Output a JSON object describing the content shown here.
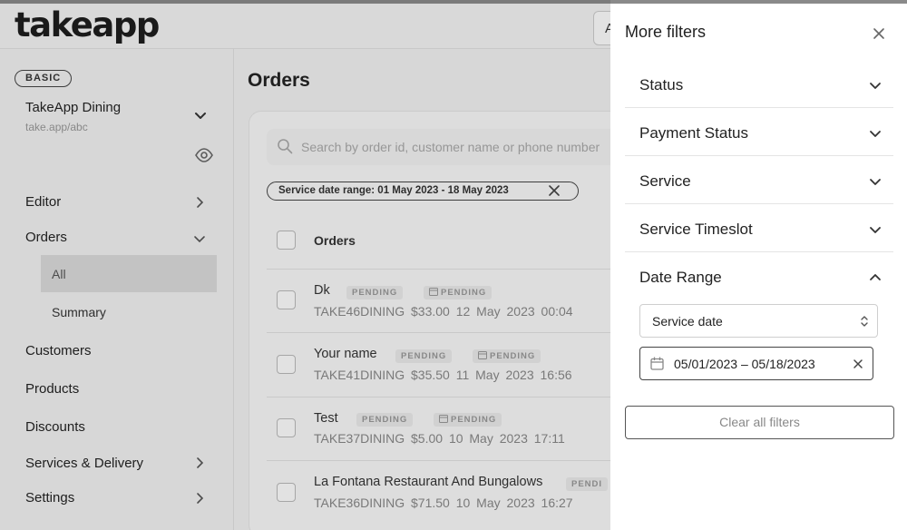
{
  "app": {
    "logo": "takeapp",
    "top_box_text": "A"
  },
  "sidebar": {
    "plan_badge": "BASIC",
    "store_name": "TakeApp Dining",
    "store_url": "take.app/abc",
    "items": [
      {
        "label": "Editor",
        "has_chevron": true,
        "chevron": "right"
      },
      {
        "label": "Orders",
        "has_chevron": true,
        "chevron": "down"
      },
      {
        "label": "Customers"
      },
      {
        "label": "Products"
      },
      {
        "label": "Discounts"
      },
      {
        "label": "Services & Delivery",
        "has_chevron": true,
        "chevron": "right"
      },
      {
        "label": "Settings",
        "has_chevron": true,
        "chevron": "right"
      }
    ],
    "orders_sub": {
      "active": "All",
      "second": "Summary"
    }
  },
  "main": {
    "title": "Orders",
    "search_placeholder": "Search by order id, customer name or phone number",
    "active_filter_chip": "Service date range: 01 May 2023 - 18 May 2023",
    "column_header": "Orders",
    "orders": [
      {
        "name": "Dk",
        "status": "PENDING",
        "payment": "PENDING",
        "id": "TAKE46DINING",
        "amount": "$33.00",
        "date": "12 May 2023 00:04"
      },
      {
        "name": "Your name",
        "status": "PENDING",
        "payment": "PENDING",
        "id": "TAKE41DINING",
        "amount": "$35.50",
        "date": "11 May 2023 16:56"
      },
      {
        "name": "Test",
        "status": "PENDING",
        "payment": "PENDING",
        "id": "TAKE37DINING",
        "amount": "$5.00",
        "date": "10 May 2023 17:11"
      },
      {
        "name": "La Fontana Restaurant And Bungalows",
        "status": "PENDI",
        "id": "TAKE36DINING",
        "amount": "$71.50",
        "date": "10 May 2023 16:27"
      }
    ]
  },
  "drawer": {
    "title": "More filters",
    "sections": [
      {
        "label": "Status",
        "expanded": false
      },
      {
        "label": "Payment Status",
        "expanded": false
      },
      {
        "label": "Service",
        "expanded": false
      },
      {
        "label": "Service Timeslot",
        "expanded": false
      },
      {
        "label": "Date Range",
        "expanded": true
      }
    ],
    "date_type_value": "Service date",
    "date_range_value": "05/01/2023 – 05/18/2023",
    "clear_all_label": "Clear all filters"
  },
  "colors": {
    "border_dark": "#444444",
    "muted_text": "#888888",
    "active_nav_bg": "#dcdcdc"
  },
  "icons": [
    "chevron-down-icon",
    "chevron-right-icon",
    "chevron-up-icon",
    "eye-icon",
    "search-icon",
    "close-icon",
    "calendar-icon",
    "updown-arrows-icon"
  ]
}
